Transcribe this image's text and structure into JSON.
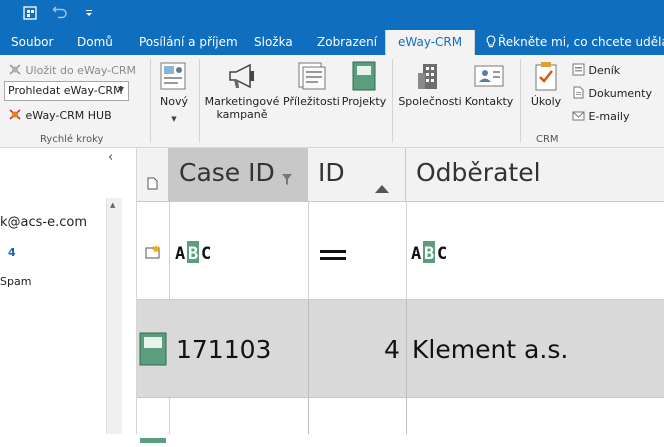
{
  "titlebar": {
    "icons": [
      "app-icon",
      "undo-icon",
      "customize-qat-icon"
    ]
  },
  "tabs": [
    "Soubor",
    "Domů",
    "Posílání a příjem",
    "Složka",
    "Zobrazení",
    "eWay-CRM"
  ],
  "tellme": "Řekněte mi, co chcete udělat...",
  "ribbon": {
    "quick": {
      "save_label": "Uložit do eWay-CRM",
      "search_value": "Prohledat eWay-CRM",
      "hub_label": "eWay-CRM HUB",
      "group_label": "Rychlé kroky"
    },
    "new_label": "Nový",
    "marketing_label": "Marketingové kampaně",
    "marketing_line1": "Marketingové",
    "marketing_line2": "kampaně",
    "opportunities_label": "Příležitosti",
    "projects_label": "Projekty",
    "companies_label": "Společnosti",
    "contacts_label": "Kontakty",
    "tasks_label": "Úkoly",
    "journal_label": "Deník",
    "documents_label": "Dokumenty",
    "emails_label": "E-maily",
    "crm_group_label": "CRM"
  },
  "leftpane": {
    "email": "k@acs-e.com",
    "count": "4",
    "folder": "Spam"
  },
  "grid": {
    "columns": [
      "Case ID",
      "ID",
      "Odběratel"
    ],
    "filter_row": {
      "case_id": "ABC",
      "id": "=",
      "customer": "ABC"
    },
    "rows": [
      {
        "case_id": "171103",
        "id": "4",
        "customer": "Klement a.s."
      }
    ]
  },
  "colors": {
    "accent": "#106ebe",
    "project_icon": "#5b9e7e"
  }
}
